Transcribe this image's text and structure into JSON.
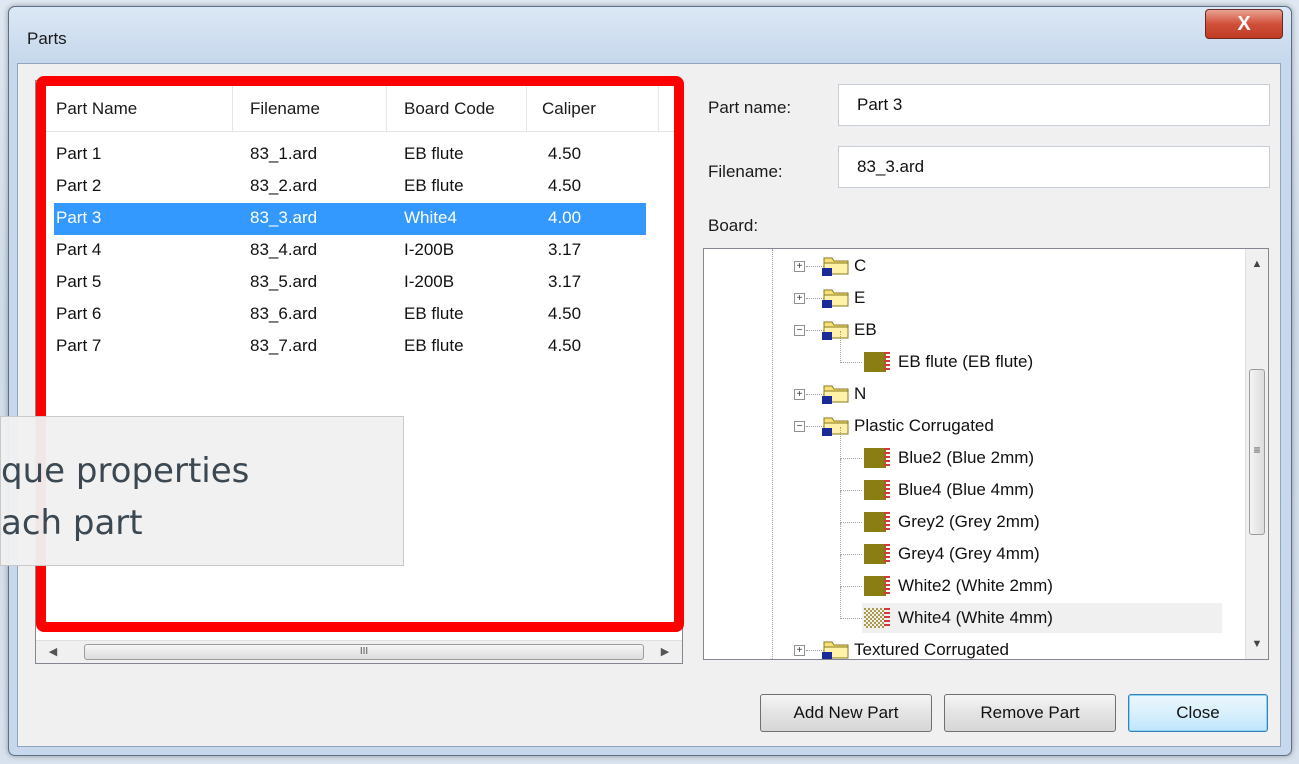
{
  "window": {
    "title": "Parts",
    "close_glyph": "X"
  },
  "list": {
    "columns": [
      "Part Name",
      "Filename",
      "Board Code",
      "Caliper"
    ],
    "rows": [
      [
        "Part 1",
        "83_1.ard",
        "EB flute",
        "4.50"
      ],
      [
        "Part 2",
        "83_2.ard",
        "EB flute",
        "4.50"
      ],
      [
        "Part 3",
        "83_3.ard",
        "White4",
        "4.00"
      ],
      [
        "Part 4",
        "83_4.ard",
        "I-200B",
        "3.17"
      ],
      [
        "Part 5",
        "83_5.ard",
        "I-200B",
        "3.17"
      ],
      [
        "Part 6",
        "83_6.ard",
        "EB flute",
        "4.50"
      ],
      [
        "Part 7",
        "83_7.ard",
        "EB flute",
        "4.50"
      ]
    ],
    "selected_row": 2,
    "scroll_grip": "III"
  },
  "callout": {
    "line1": "que properties",
    "line2": "ach part"
  },
  "form": {
    "part_name_label": "Part name:",
    "part_name_value": "Part 3",
    "filename_label": "Filename:",
    "filename_value": "83_3.ard",
    "board_label": "Board:"
  },
  "tree": {
    "nodes": [
      {
        "label": "C",
        "kind": "folder",
        "expander": "+"
      },
      {
        "label": "E",
        "kind": "folder",
        "expander": "+"
      },
      {
        "label": "EB",
        "kind": "folder",
        "expander": "−"
      },
      {
        "label": "EB flute (EB flute)",
        "kind": "board"
      },
      {
        "label": "N",
        "kind": "folder",
        "expander": "+"
      },
      {
        "label": "Plastic Corrugated",
        "kind": "folder",
        "expander": "−"
      },
      {
        "label": "Blue2 (Blue 2mm)",
        "kind": "board"
      },
      {
        "label": "Blue4 (Blue 4mm)",
        "kind": "board"
      },
      {
        "label": "Grey2 (Grey 2mm)",
        "kind": "board"
      },
      {
        "label": "Grey4 (Grey 4mm)",
        "kind": "board"
      },
      {
        "label": "White2 (White 2mm)",
        "kind": "board"
      },
      {
        "label": "White4 (White 4mm)",
        "kind": "board",
        "selected": true
      },
      {
        "label": "Textured Corrugated",
        "kind": "folder",
        "expander": "+"
      }
    ],
    "scroll_grip": "≡"
  },
  "buttons": {
    "add": "Add New Part",
    "remove": "Remove Part",
    "close": "Close"
  },
  "colors": {
    "selection": "#3399ff",
    "highlight_box": "#ff0000",
    "folder": "#f7e37a",
    "board": "#8a7d14"
  }
}
